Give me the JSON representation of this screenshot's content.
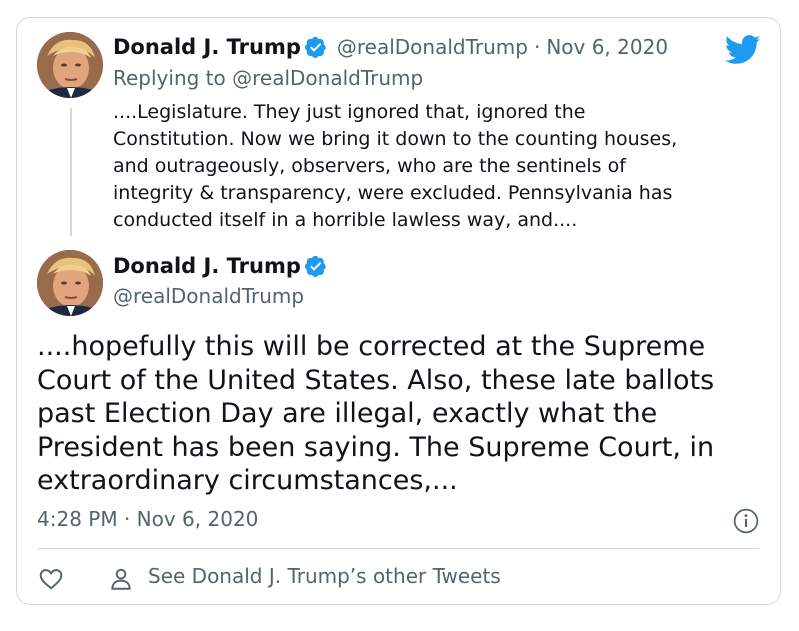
{
  "quoted_tweet": {
    "author_name": "Donald J. Trump",
    "handle": "@realDonaldTrump",
    "separator": "·",
    "date": "Nov 6, 2020",
    "replying_to": "Replying to @realDonaldTrump",
    "text": "....Legislature. They just ignored that, ignored the\nConstitution. Now we bring it down to the counting houses,\nand outrageously, observers, who are the sentinels of\nintegrity & transparency, were excluded. Pennsylvania has\nconducted itself in a horrible lawless way, and...."
  },
  "main_tweet": {
    "author_name": "Donald J. Trump",
    "handle": "@realDonaldTrump",
    "text": "....hopefully this will be corrected at the Supreme\nCourt of the United States. Also, these late ballots\npast Election Day are illegal, exactly what the\nPresident has been saying. The Supreme Court, in\nextraordinary circumstances,...",
    "timestamp": "4:28 PM · Nov 6, 2020"
  },
  "footer": {
    "other_tweets_label": "See Donald J. Trump’s other Tweets"
  },
  "colors": {
    "twitter_blue": "#1d9bf0",
    "secondary_text": "#536471",
    "border": "#cfd9de"
  }
}
